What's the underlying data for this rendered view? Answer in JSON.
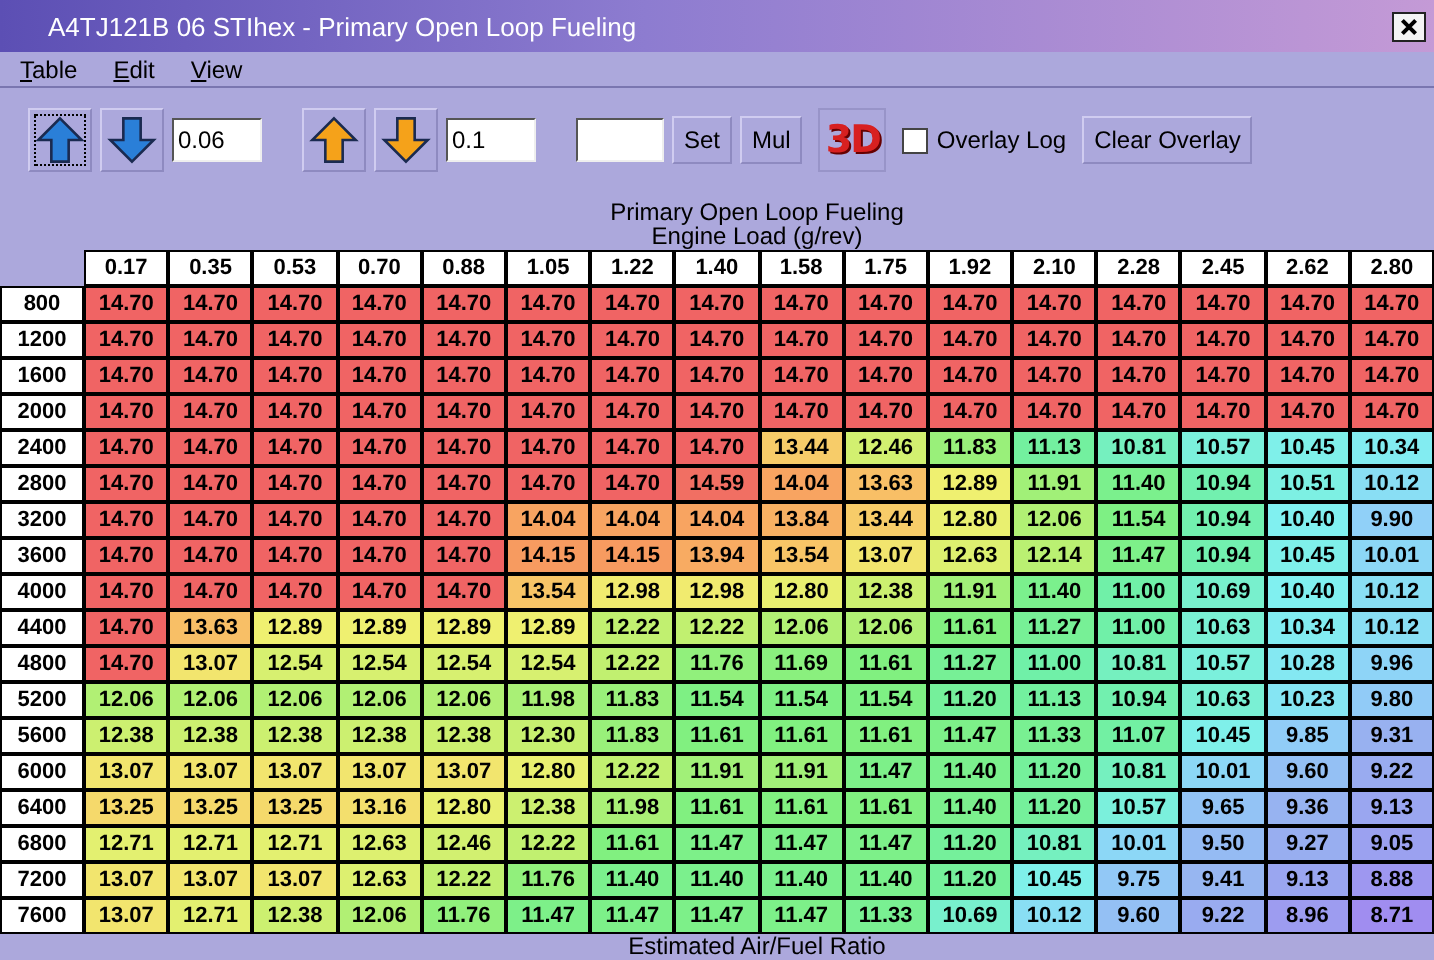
{
  "window": {
    "title": "A4TJ121B 06 STIhex - Primary Open Loop Fueling"
  },
  "menu": [
    {
      "label": "Table"
    },
    {
      "label": "Edit"
    },
    {
      "label": "View"
    }
  ],
  "toolbar": {
    "coarse_buttons": [
      {
        "kind": "up",
        "focused": true
      },
      {
        "kind": "down",
        "focused": false
      }
    ],
    "coarse_step": "0.06",
    "fine_buttons": [
      {
        "kind": "up",
        "focused": false
      },
      {
        "kind": "down",
        "focused": false
      }
    ],
    "fine_step": "0.1",
    "set_button": "Set",
    "mul_button": "Mul",
    "view_3d_button": "3D",
    "overlay_log": {
      "label": "Overlay Log",
      "checked": false
    },
    "clear_overlay_button": "Clear Overlay"
  },
  "table": {
    "title": "Primary Open Loop Fueling",
    "x_axis_label": "Engine Load (g/rev)",
    "columns": [
      "0.17",
      "0.35",
      "0.53",
      "0.70",
      "0.88",
      "1.05",
      "1.22",
      "1.40",
      "1.58",
      "1.75",
      "1.92",
      "2.10",
      "2.28",
      "2.45",
      "2.62",
      "2.80"
    ],
    "rows": [
      {
        "rpm": "800",
        "values": [
          "14.70",
          "14.70",
          "14.70",
          "14.70",
          "14.70",
          "14.70",
          "14.70",
          "14.70",
          "14.70",
          "14.70",
          "14.70",
          "14.70",
          "14.70",
          "14.70",
          "14.70",
          "14.70"
        ]
      },
      {
        "rpm": "1200",
        "values": [
          "14.70",
          "14.70",
          "14.70",
          "14.70",
          "14.70",
          "14.70",
          "14.70",
          "14.70",
          "14.70",
          "14.70",
          "14.70",
          "14.70",
          "14.70",
          "14.70",
          "14.70",
          "14.70"
        ]
      },
      {
        "rpm": "1600",
        "values": [
          "14.70",
          "14.70",
          "14.70",
          "14.70",
          "14.70",
          "14.70",
          "14.70",
          "14.70",
          "14.70",
          "14.70",
          "14.70",
          "14.70",
          "14.70",
          "14.70",
          "14.70",
          "14.70"
        ]
      },
      {
        "rpm": "2000",
        "values": [
          "14.70",
          "14.70",
          "14.70",
          "14.70",
          "14.70",
          "14.70",
          "14.70",
          "14.70",
          "14.70",
          "14.70",
          "14.70",
          "14.70",
          "14.70",
          "14.70",
          "14.70",
          "14.70"
        ]
      },
      {
        "rpm": "2400",
        "values": [
          "14.70",
          "14.70",
          "14.70",
          "14.70",
          "14.70",
          "14.70",
          "14.70",
          "14.70",
          "13.44",
          "12.46",
          "11.83",
          "11.13",
          "10.81",
          "10.57",
          "10.45",
          "10.34"
        ]
      },
      {
        "rpm": "2800",
        "values": [
          "14.70",
          "14.70",
          "14.70",
          "14.70",
          "14.70",
          "14.70",
          "14.70",
          "14.59",
          "14.04",
          "13.63",
          "12.89",
          "11.91",
          "11.40",
          "10.94",
          "10.51",
          "10.12"
        ]
      },
      {
        "rpm": "3200",
        "values": [
          "14.70",
          "14.70",
          "14.70",
          "14.70",
          "14.70",
          "14.04",
          "14.04",
          "14.04",
          "13.84",
          "13.44",
          "12.80",
          "12.06",
          "11.54",
          "10.94",
          "10.40",
          "9.90"
        ]
      },
      {
        "rpm": "3600",
        "values": [
          "14.70",
          "14.70",
          "14.70",
          "14.70",
          "14.70",
          "14.15",
          "14.15",
          "13.94",
          "13.54",
          "13.07",
          "12.63",
          "12.14",
          "11.47",
          "10.94",
          "10.45",
          "10.01"
        ]
      },
      {
        "rpm": "4000",
        "values": [
          "14.70",
          "14.70",
          "14.70",
          "14.70",
          "14.70",
          "13.54",
          "12.98",
          "12.98",
          "12.80",
          "12.38",
          "11.91",
          "11.40",
          "11.00",
          "10.69",
          "10.40",
          "10.12"
        ]
      },
      {
        "rpm": "4400",
        "values": [
          "14.70",
          "13.63",
          "12.89",
          "12.89",
          "12.89",
          "12.89",
          "12.22",
          "12.22",
          "12.06",
          "12.06",
          "11.61",
          "11.27",
          "11.00",
          "10.63",
          "10.34",
          "10.12"
        ]
      },
      {
        "rpm": "4800",
        "values": [
          "14.70",
          "13.07",
          "12.54",
          "12.54",
          "12.54",
          "12.54",
          "12.22",
          "11.76",
          "11.69",
          "11.61",
          "11.27",
          "11.00",
          "10.81",
          "10.57",
          "10.28",
          "9.96"
        ]
      },
      {
        "rpm": "5200",
        "values": [
          "12.06",
          "12.06",
          "12.06",
          "12.06",
          "12.06",
          "11.98",
          "11.83",
          "11.54",
          "11.54",
          "11.54",
          "11.20",
          "11.13",
          "10.94",
          "10.63",
          "10.23",
          "9.80"
        ]
      },
      {
        "rpm": "5600",
        "values": [
          "12.38",
          "12.38",
          "12.38",
          "12.38",
          "12.38",
          "12.30",
          "11.83",
          "11.61",
          "11.61",
          "11.61",
          "11.47",
          "11.33",
          "11.07",
          "10.45",
          "9.85",
          "9.31"
        ]
      },
      {
        "rpm": "6000",
        "values": [
          "13.07",
          "13.07",
          "13.07",
          "13.07",
          "13.07",
          "12.80",
          "12.22",
          "11.91",
          "11.91",
          "11.47",
          "11.40",
          "11.20",
          "10.81",
          "10.01",
          "9.60",
          "9.22"
        ]
      },
      {
        "rpm": "6400",
        "values": [
          "13.25",
          "13.25",
          "13.25",
          "13.16",
          "12.80",
          "12.38",
          "11.98",
          "11.61",
          "11.61",
          "11.61",
          "11.40",
          "11.20",
          "10.57",
          "9.65",
          "9.36",
          "9.13"
        ]
      },
      {
        "rpm": "6800",
        "values": [
          "12.71",
          "12.71",
          "12.71",
          "12.63",
          "12.46",
          "12.22",
          "11.61",
          "11.47",
          "11.47",
          "11.47",
          "11.20",
          "10.81",
          "10.01",
          "9.50",
          "9.27",
          "9.05"
        ]
      },
      {
        "rpm": "7200",
        "values": [
          "13.07",
          "13.07",
          "13.07",
          "12.63",
          "12.22",
          "11.76",
          "11.40",
          "11.40",
          "11.40",
          "11.40",
          "11.20",
          "10.45",
          "9.75",
          "9.41",
          "9.13",
          "8.88"
        ]
      },
      {
        "rpm": "7600",
        "values": [
          "13.07",
          "12.71",
          "12.38",
          "12.06",
          "11.76",
          "11.47",
          "11.47",
          "11.47",
          "11.47",
          "11.33",
          "10.69",
          "10.12",
          "9.60",
          "9.22",
          "8.96",
          "8.71"
        ]
      }
    ],
    "footer": "Estimated Air/Fuel Ratio"
  }
}
